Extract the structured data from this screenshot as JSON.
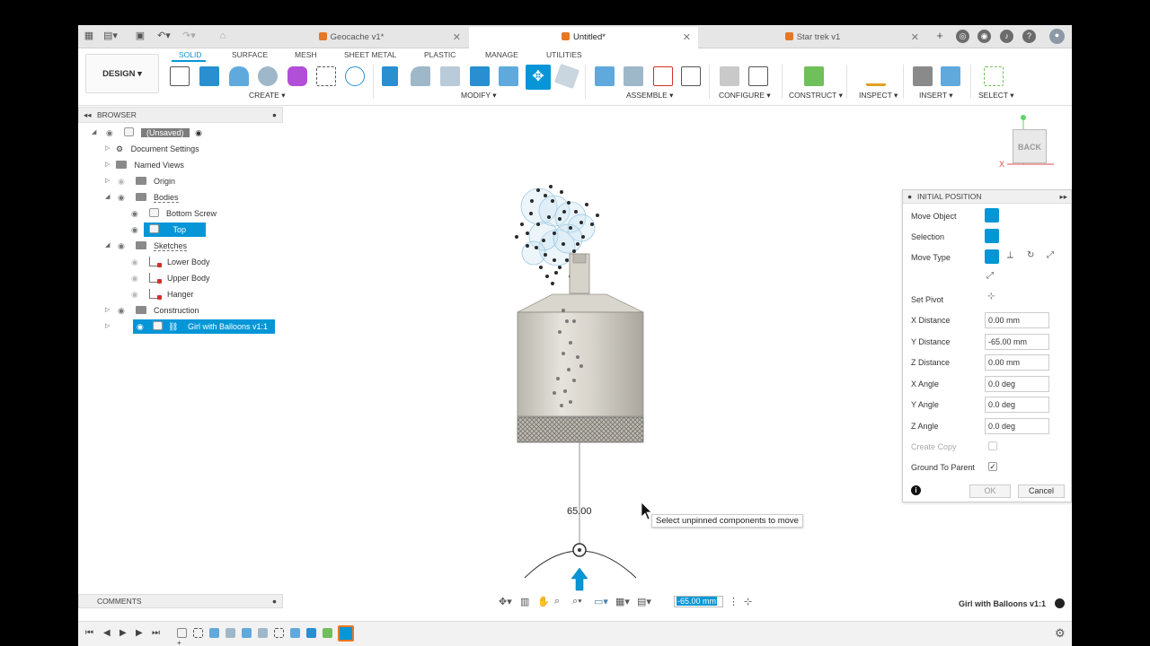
{
  "tabs": [
    {
      "label": "Geocache v1*",
      "active": false
    },
    {
      "label": "Untitled*",
      "active": true
    },
    {
      "label": "Star trek v1",
      "active": false
    }
  ],
  "ribbon": {
    "design_label": "DESIGN ▾",
    "tabs": [
      "SOLID",
      "SURFACE",
      "MESH",
      "SHEET METAL",
      "PLASTIC",
      "MANAGE",
      "UTILITIES"
    ],
    "active_tab": "SOLID",
    "groups": [
      "CREATE ▾",
      "MODIFY ▾",
      "ASSEMBLE ▾",
      "CONFIGURE ▾",
      "CONSTRUCT ▾",
      "INSPECT ▾",
      "INSERT ▾",
      "SELECT ▾"
    ]
  },
  "browser": {
    "title": "BROWSER",
    "items": [
      {
        "label": "(Unsaved)",
        "type": "root"
      },
      {
        "label": "Document Settings",
        "type": "gear"
      },
      {
        "label": "Named Views",
        "type": "folder"
      },
      {
        "label": "Origin",
        "type": "folder"
      },
      {
        "label": "Bodies",
        "type": "folder"
      },
      {
        "label": "Bottom Screw",
        "type": "body"
      },
      {
        "label": "Top",
        "type": "body",
        "selected": true
      },
      {
        "label": "Sketches",
        "type": "folder"
      },
      {
        "label": "Lower Body",
        "type": "sketch"
      },
      {
        "label": "Upper Body",
        "type": "sketch"
      },
      {
        "label": "Hanger",
        "type": "sketch"
      },
      {
        "label": "Construction",
        "type": "folder"
      },
      {
        "label": "Girl with Balloons v1:1",
        "type": "component",
        "selected": true
      }
    ]
  },
  "viewcube": {
    "face": "BACK",
    "axis_x": "X"
  },
  "dialog": {
    "title": "INITIAL POSITION",
    "move_object_label": "Move Object",
    "selection_label": "Selection",
    "move_type_label": "Move Type",
    "set_pivot_label": "Set Pivot",
    "x_distance_label": "X Distance",
    "x_distance": "0.00 mm",
    "y_distance_label": "Y Distance",
    "y_distance": "-65.00 mm",
    "z_distance_label": "Z Distance",
    "z_distance": "0.00 mm",
    "x_angle_label": "X Angle",
    "x_angle": "0.0 deg",
    "y_angle_label": "Y Angle",
    "y_angle": "0.0 deg",
    "z_angle_label": "Z Angle",
    "z_angle": "0.0 deg",
    "create_copy_label": "Create Copy",
    "create_copy": false,
    "ground_label": "Ground To Parent",
    "ground": true,
    "ok_label": "OK",
    "cancel_label": "Cancel"
  },
  "viewport": {
    "dimension_label": "65.00",
    "tooltip": "Select unpinned components to move",
    "distance_input": "-65.00 mm"
  },
  "comments_label": "COMMENTS",
  "status_right": "Girl with Balloons v1:1",
  "colors": {
    "accent": "#0696d7",
    "brand_orange": "#e87722"
  }
}
